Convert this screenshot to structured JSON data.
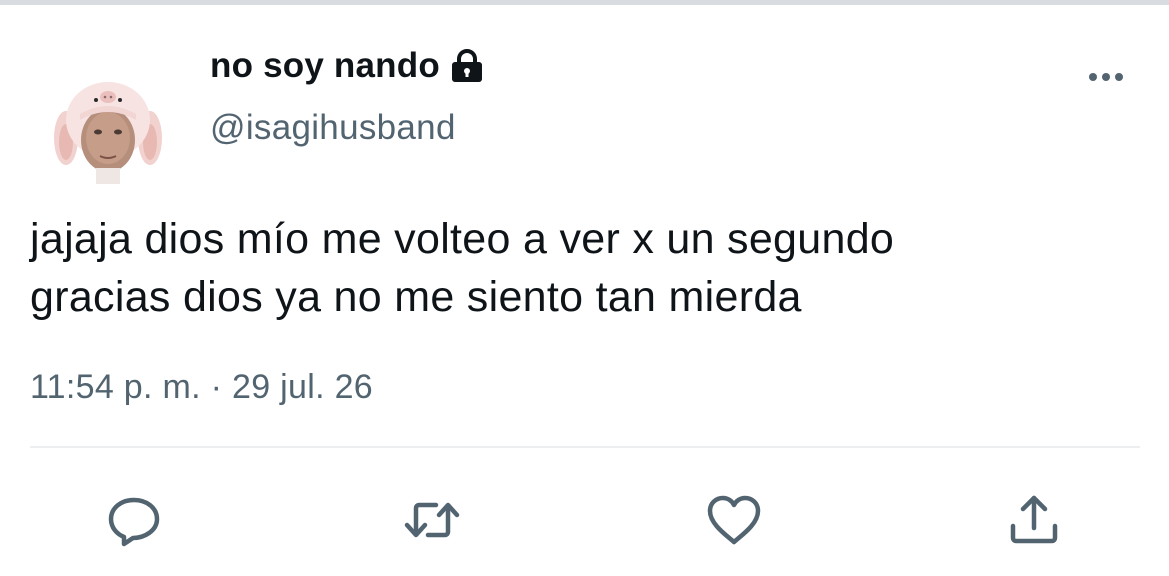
{
  "tweet": {
    "display_name": "no soy nando",
    "handle": "@isagihusband",
    "text_lines": [
      "jajaja dios mío me volteo a ver x un segundo",
      "gracias dios ya no me siento tan mierda"
    ],
    "time": "11:54 p. m.",
    "separator": " · ",
    "date": "29 jul. 26"
  },
  "icons": {
    "lock": "lock-icon",
    "more": "more-icon",
    "reply": "reply-icon",
    "retweet": "retweet-icon",
    "like": "like-icon",
    "share": "share-icon"
  },
  "colors": {
    "text": "#0f1419",
    "secondary": "#536471",
    "icon": "#536471"
  }
}
